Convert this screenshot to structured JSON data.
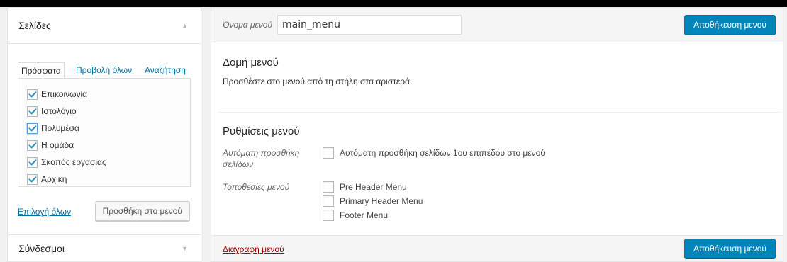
{
  "left": {
    "pages_section": {
      "title": "Σελίδες",
      "tabs": [
        "Πρόσφατα",
        "Προβολή όλων",
        "Αναζήτηση"
      ],
      "items": [
        {
          "label": "Επικοινωνία",
          "checked": true
        },
        {
          "label": "Ιστολόγιο",
          "checked": true
        },
        {
          "label": "Πολυμέσα",
          "checked": true
        },
        {
          "label": "Η ομάδα",
          "checked": true
        },
        {
          "label": "Σκοπός εργασίας",
          "checked": true
        },
        {
          "label": "Αρχική",
          "checked": true
        }
      ],
      "select_all": "Επιλογή όλων",
      "add_button": "Προσθήκη στο μενού"
    },
    "links_section": {
      "title": "Σύνδεσμοι"
    }
  },
  "menu": {
    "name_label": "Όνομα μενού",
    "name_value": "main_menu",
    "save_label": "Αποθήκευση μενού",
    "structure_title": "Δομή μενού",
    "structure_desc": "Προσθέστε στο μενού από τη στήλη στα αριστερά.",
    "settings_title": "Ρυθμίσεις μενού",
    "auto_add_label": "Αυτόματη προσθήκη σελίδων",
    "auto_add_option": "Αυτόματη προσθήκη σελίδων 1ου επιπέδου στο μενού",
    "locations_label": "Τοποθεσίες μενού",
    "locations": [
      "Pre Header Menu",
      "Primary Header Menu",
      "Footer Menu"
    ],
    "delete_label": "Διαγραφή μενού"
  },
  "colors": {
    "primary": "#0085ba",
    "link": "#0073aa",
    "delete": "#aa0000"
  }
}
